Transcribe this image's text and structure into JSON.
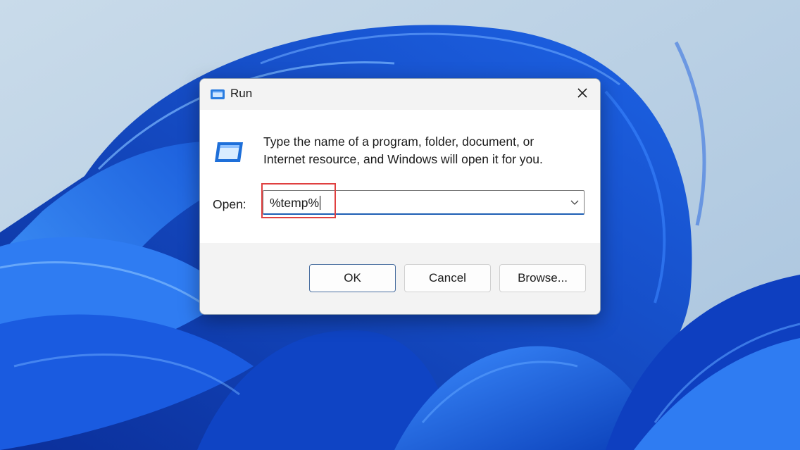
{
  "window": {
    "title": "Run",
    "title_icon": "run-icon",
    "close_icon": "close-icon"
  },
  "dialog": {
    "description": "Type the name of a program, folder, document, or\nInternet resource, and Windows will open it for you.",
    "icon": "run-program-icon",
    "open_label": "Open:",
    "input_value": "%temp%",
    "dropdown_icon": "chevron-down-icon"
  },
  "buttons": {
    "ok": "OK",
    "cancel": "Cancel",
    "browse": "Browse..."
  },
  "colors": {
    "accent": "#1e5fb4",
    "highlight": "#e04040",
    "wallpaper_blue": "#1565e0"
  }
}
